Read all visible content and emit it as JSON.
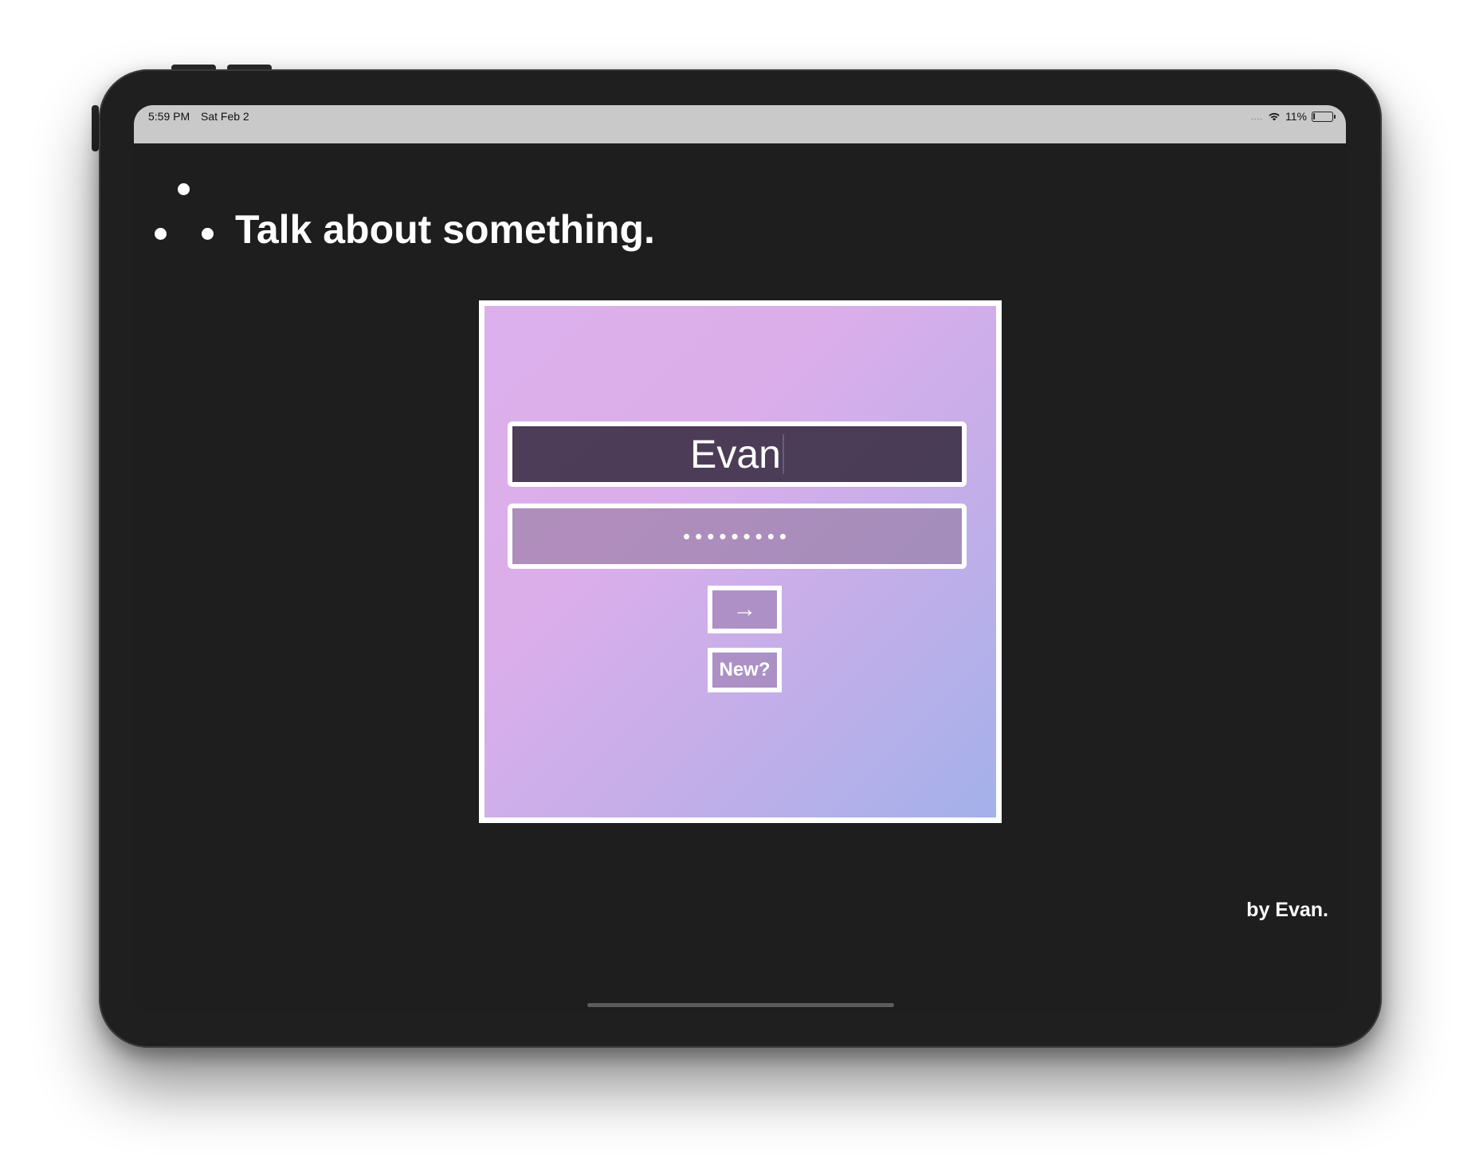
{
  "status_bar": {
    "time": "5:59 PM",
    "date": "Sat Feb 2",
    "signal": "....",
    "battery_percent": "11%",
    "battery_level": 0.11
  },
  "app": {
    "title": "Talk about something.",
    "credit": "by Evan."
  },
  "login": {
    "username_value": "Evan",
    "password_mask": "•••••••••",
    "submit_label": "→",
    "new_label": "New?"
  },
  "icons": {
    "wifi": "wifi-icon",
    "battery": "battery-icon",
    "logo": "three-dots-logo-icon"
  },
  "colors": {
    "background": "#1e1e1e",
    "status_bar": "#c9c9c9",
    "card_gradient_start": "#dcb0ec",
    "card_gradient_end": "#a3b1ea",
    "text": "#ffffff"
  }
}
